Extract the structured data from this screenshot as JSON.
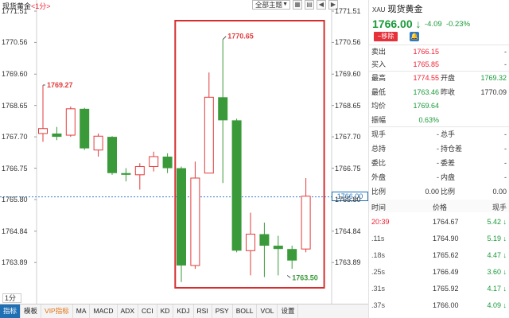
{
  "header": {
    "symbol": "现货黄金",
    "period_tag": "1分",
    "indicator_select": "全部主题",
    "icons": [
      "grid-icon",
      "layout-icon",
      "prev-icon",
      "next-icon"
    ]
  },
  "y_axis": {
    "labels": [
      "1771.51",
      "1770.56",
      "1769.60",
      "1768.65",
      "1767.70",
      "1766.75",
      "1765.80",
      "1764.84",
      "1763.89"
    ]
  },
  "annotations": {
    "high": "1770.65",
    "low": "1763.50",
    "left_marker": "1769.27",
    "current_price": "1766.00"
  },
  "chart_data": {
    "type": "candlestick",
    "ylim": [
      1763.1,
      1771.51
    ],
    "reference_line": 1765.88,
    "candles": [
      {
        "o": 1767.8,
        "c": 1767.95,
        "h": 1769.27,
        "l": 1767.55
      },
      {
        "o": 1767.8,
        "c": 1767.7,
        "h": 1768.0,
        "l": 1767.6
      },
      {
        "o": 1767.75,
        "c": 1768.55,
        "h": 1768.62,
        "l": 1767.7
      },
      {
        "o": 1768.55,
        "c": 1767.35,
        "h": 1768.58,
        "l": 1767.3
      },
      {
        "o": 1767.3,
        "c": 1767.72,
        "h": 1767.8,
        "l": 1767.1
      },
      {
        "o": 1767.7,
        "c": 1766.6,
        "h": 1767.72,
        "l": 1766.55
      },
      {
        "o": 1766.6,
        "c": 1766.55,
        "h": 1766.75,
        "l": 1766.35
      },
      {
        "o": 1766.55,
        "c": 1766.8,
        "h": 1766.9,
        "l": 1766.1
      },
      {
        "o": 1766.8,
        "c": 1767.1,
        "h": 1767.25,
        "l": 1766.65
      },
      {
        "o": 1767.1,
        "c": 1766.75,
        "h": 1767.2,
        "l": 1766.6
      },
      {
        "o": 1766.75,
        "c": 1763.8,
        "h": 1766.8,
        "l": 1763.3
      },
      {
        "o": 1763.8,
        "c": 1766.45,
        "h": 1766.95,
        "l": 1763.7
      },
      {
        "o": 1766.6,
        "c": 1768.9,
        "h": 1769.65,
        "l": 1766.6
      },
      {
        "o": 1768.9,
        "c": 1768.2,
        "h": 1770.65,
        "l": 1766.3
      },
      {
        "o": 1768.2,
        "c": 1764.25,
        "h": 1768.25,
        "l": 1764.2
      },
      {
        "o": 1764.25,
        "c": 1764.75,
        "h": 1765.4,
        "l": 1763.5
      },
      {
        "o": 1764.75,
        "c": 1764.4,
        "h": 1765.1,
        "l": 1763.45
      },
      {
        "o": 1764.4,
        "c": 1764.3,
        "h": 1764.7,
        "l": 1763.5
      },
      {
        "o": 1764.3,
        "c": 1763.95,
        "h": 1764.4,
        "l": 1763.7
      },
      {
        "o": 1764.3,
        "c": 1765.9,
        "h": 1766.45,
        "l": 1764.2
      }
    ]
  },
  "period_selector": "1分",
  "bottom_tabs": [
    "指标",
    "模板",
    "VIP指标",
    "MA",
    "MACD",
    "ADX",
    "CCI",
    "KD",
    "KDJ",
    "RSI",
    "PSY",
    "BOLL",
    "VOL",
    "设置"
  ],
  "quote": {
    "code": "XAU",
    "name": "现货黄金",
    "price": "1766.00",
    "arrow": "↓",
    "change": "-4.09",
    "change_pct": "-0.23%",
    "remove_label": "移除",
    "sell_label": "卖出",
    "sell": "1766.15",
    "sell_extra": "-",
    "buy_label": "买入",
    "buy": "1765.85",
    "buy_extra": "-",
    "stats": [
      {
        "l1": "最高",
        "v1": "1774.55",
        "c1": "red",
        "l2": "开盘",
        "v2": "1769.32",
        "c2": "green"
      },
      {
        "l1": "最低",
        "v1": "1763.46",
        "c1": "green",
        "l2": "昨收",
        "v2": "1770.09",
        "c2": ""
      },
      {
        "l1": "均价",
        "v1": "1769.64",
        "c1": "green",
        "l2": "",
        "v2": "",
        "c2": ""
      },
      {
        "l1": "振幅",
        "v1": "0.63%",
        "c1": "green",
        "l2": "",
        "v2": "",
        "c2": ""
      }
    ],
    "stats2": [
      {
        "l1": "现手",
        "v1": "-",
        "l2": "总手",
        "v2": "-"
      },
      {
        "l1": "总持",
        "v1": "-",
        "l2": "持仓差",
        "v2": "-"
      },
      {
        "l1": "委比",
        "v1": "-",
        "l2": "委差",
        "v2": "-"
      },
      {
        "l1": "外盘",
        "v1": "-",
        "l2": "内盘",
        "v2": "-"
      },
      {
        "l1": "比例",
        "v1": "0.00",
        "l2": "比例",
        "v2": "0.00"
      }
    ]
  },
  "ticks": {
    "headers": [
      "时间",
      "价格",
      "现手"
    ],
    "rows": [
      {
        "time": "20:39",
        "price": "1764.67",
        "vol": "5.42",
        "arrow": "↓"
      },
      {
        "time": ".11s",
        "price": "1764.90",
        "vol": "5.19",
        "arrow": "↓"
      },
      {
        "time": ".18s",
        "price": "1765.62",
        "vol": "4.47",
        "arrow": "↓"
      },
      {
        "time": ".25s",
        "price": "1766.49",
        "vol": "3.60",
        "arrow": "↓"
      },
      {
        "time": ".31s",
        "price": "1765.92",
        "vol": "4.17",
        "arrow": "↓"
      },
      {
        "time": ".37s",
        "price": "1766.00",
        "vol": "4.09",
        "arrow": "↓"
      }
    ]
  },
  "colors": {
    "up": "#e23b3b",
    "down": "#3a9a3a",
    "highlight_box": "#d62e2e",
    "ref_line": "#3b7fd0"
  }
}
